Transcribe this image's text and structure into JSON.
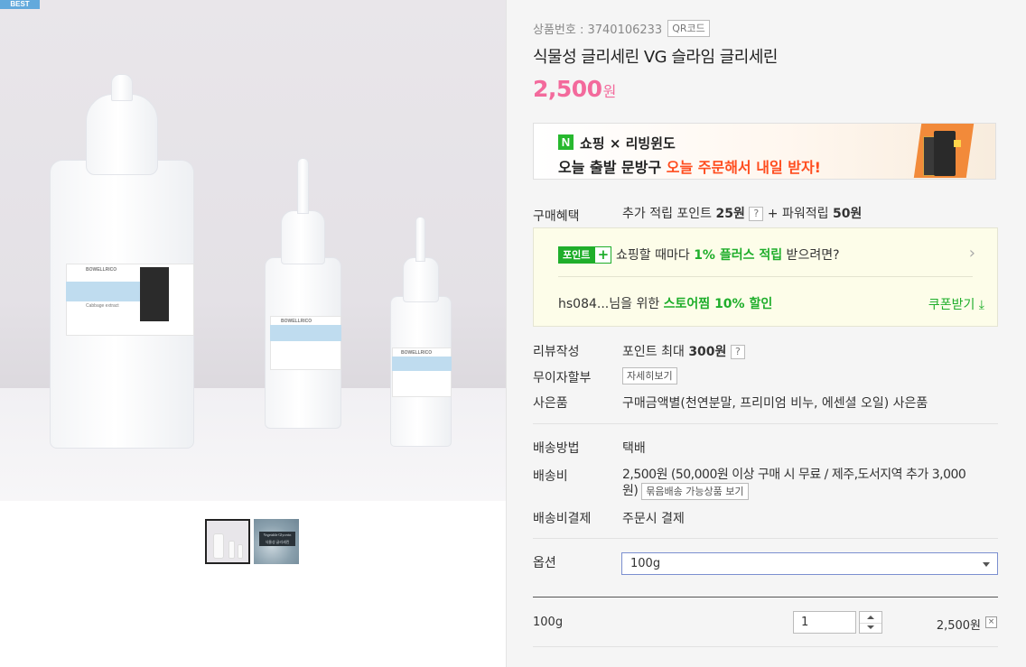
{
  "left": {
    "badge": "BEST",
    "bottle_labels": {
      "brand": "BOWELLRICO",
      "sub": "Cabbage extract"
    },
    "thumb2_text": [
      "Vegetable Glycerin",
      "식물성 글리세린"
    ]
  },
  "product": {
    "code_label": "상품번호 : 3740106233",
    "qr_button": "QR코드",
    "title": "식물성 글리세린 VG 슬라임 글리세린",
    "price_number": "2,500",
    "price_unit": "원"
  },
  "banner": {
    "logo": "N",
    "line1": "쇼핑 × 리빙윈도",
    "line2_prefix": "오늘 출발 문방구 ",
    "line2_highlight": "오늘 주문해서 내일 받자!"
  },
  "benefit": {
    "label": "구매혜택",
    "text1": "추가 적립 포인트 ",
    "points": "25원",
    "qmark": "?",
    "text2": " + 파워적립 ",
    "power_points": "50원"
  },
  "pointbox": {
    "badge_text": "포인트",
    "badge_plus": "+",
    "line1_prefix": "쇼핑할 때마다 ",
    "line1_highlight": "1% 플러스 적립",
    "line1_suffix": " 받으려면?",
    "arrow": "›",
    "line2_prefix": "hs084...님을 위한 ",
    "line2_highlight": "스토어찜 10% 할인",
    "coupon": "쿠폰받기 ⤓"
  },
  "review": {
    "label": "리뷰작성",
    "text": "포인트 최대 ",
    "amount": "300원",
    "qmark": "?"
  },
  "installment": {
    "label": "무이자할부",
    "button": "자세히보기"
  },
  "gift": {
    "label": "사은품",
    "text": "구매금액별(천연분말, 프리미엄 비누, 에센셜 오일) 사은품"
  },
  "shipping": {
    "method_label": "배송방법",
    "method": "택배",
    "fee_label": "배송비",
    "fee_line1": "2,500원 (50,000원 이상 구매 시 무료 / 제주,도서지역 추가 3,000",
    "fee_line2": "원)",
    "bundle_button": "묶음배송 가능상품 보기",
    "payment_label": "배송비결제",
    "payment": "주문시 결제"
  },
  "option": {
    "label": "옵션",
    "selected": "100g"
  },
  "order_line": {
    "name": "100g",
    "quantity": "1",
    "price": "2,500원",
    "remove": "×"
  }
}
